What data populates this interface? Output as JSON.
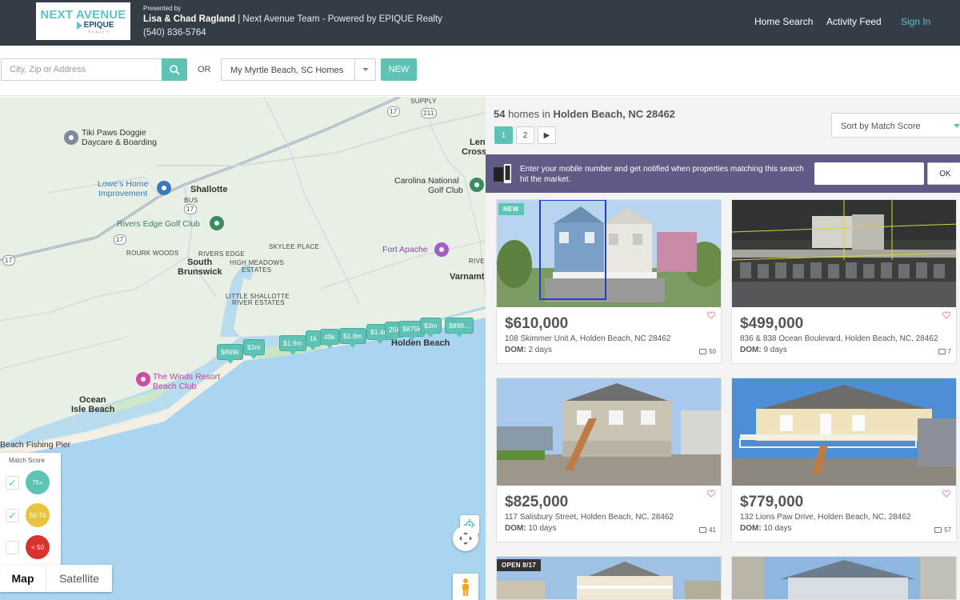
{
  "header": {
    "logo_main": "NEXT AVENUE",
    "logo_sub": "EPIQUE",
    "logo_sub2": "REALTY",
    "presented_by": "Presented by",
    "agent_names": "Lisa & Chad Ragland",
    "agent_team": " | Next Avenue Team - Powered by EPIQUE Realty",
    "phone": "(540) 836-5764",
    "nav": {
      "home_search": "Home Search",
      "activity_feed": "Activity Feed",
      "sign_in": "Sign In"
    }
  },
  "search": {
    "placeholder": "City, Zip or Address",
    "or_label": "OR",
    "saved_search": "My Myrtle Beach, SC Homes",
    "new_button": "NEW"
  },
  "map": {
    "labels": {
      "tiki": "Tiki Paws Doggie",
      "tiki2": "Daycare & Boarding",
      "lowes": "Lowe's Home",
      "lowes2": "Improvement",
      "shallotte": "Shallotte",
      "rivers_edge_golf": "Rivers Edge Golf Club",
      "rivers_edge": "RIVERS EDGE",
      "rourk_woods": "ROURK WOODS",
      "skylee_place": "SKYLEE PLACE",
      "high_meadows": "HIGH MEADOWS",
      "estates": "ESTATES",
      "south": "South",
      "brunswick": "Brunswick",
      "little_shallotte": "LITTLE SHALLOTTE",
      "river_estates": "RIVER ESTATES",
      "fort_apache": "Fort Apache",
      "carolina_national": "Carolina National",
      "golf_club": "Golf Club",
      "varnamt": "Varnamt",
      "rive": "RIVE",
      "lena": "Len",
      "cross": "Cross",
      "supply": "SUPPLY",
      "holden_beach": "Holden Beach",
      "winds_resort": "The Winds Resort",
      "beach_club": "Beach Club",
      "ocean": "Ocean",
      "isle_beach": "Isle Beach",
      "fishing_pier": "Beach Fishing Pier",
      "r17a": "17",
      "r17b": "17",
      "r17c": "17",
      "r17d": "17",
      "r211": "211",
      "bus": "BUS"
    },
    "pins": [
      "$899k",
      "$3m",
      "$1.9m",
      "1k",
      "49k",
      "$1.8m",
      "$1.4m",
      "25k",
      "$875k",
      "$3m",
      "$899..."
    ],
    "legend": {
      "title": "Match Score",
      "rows": [
        {
          "label": "75+",
          "checked": true,
          "color": "#5ec2b5"
        },
        {
          "label": "50-74",
          "checked": true,
          "color": "#e8c33f"
        },
        {
          "label": "< 50",
          "checked": false,
          "color": "#d4342c"
        }
      ]
    },
    "map_type": {
      "map": "Map",
      "satellite": "Satellite"
    }
  },
  "results": {
    "count": "54",
    "count_text": " homes in ",
    "location": "Holden Beach, NC 28462",
    "pages": [
      "1",
      "2"
    ],
    "next": "▶",
    "sort": "Sort by Match Score",
    "notify_text": "Enter your mobile number and get notified when properties matching this search hit the market.",
    "notify_ok": "OK",
    "listings": [
      {
        "badge": "NEW",
        "price": "$610,000",
        "address": "108 Skimmer Unit A, Holden Beach, NC 28462",
        "dom_label": "DOM:",
        "dom": " 2 days",
        "photos": "50"
      },
      {
        "badge": "",
        "price": "$499,000",
        "address": "836 & 838 Ocean Boulevard, Holden Beach, NC, 28462",
        "dom_label": "DOM:",
        "dom": " 9 days",
        "photos": "7"
      },
      {
        "badge": "",
        "price": "$825,000",
        "address": "117 Salisbury Street, Holden Beach, NC, 28462",
        "dom_label": "DOM:",
        "dom": " 10 days",
        "photos": "41"
      },
      {
        "badge": "",
        "price": "$779,000",
        "address": "132 Lions Paw Drive, Holden Beach, NC, 28462",
        "dom_label": "DOM:",
        "dom": " 10 days",
        "photos": "57"
      },
      {
        "badge": "OPEN 8/17",
        "price": "",
        "address": "",
        "dom_label": "",
        "dom": "",
        "photos": ""
      }
    ]
  }
}
